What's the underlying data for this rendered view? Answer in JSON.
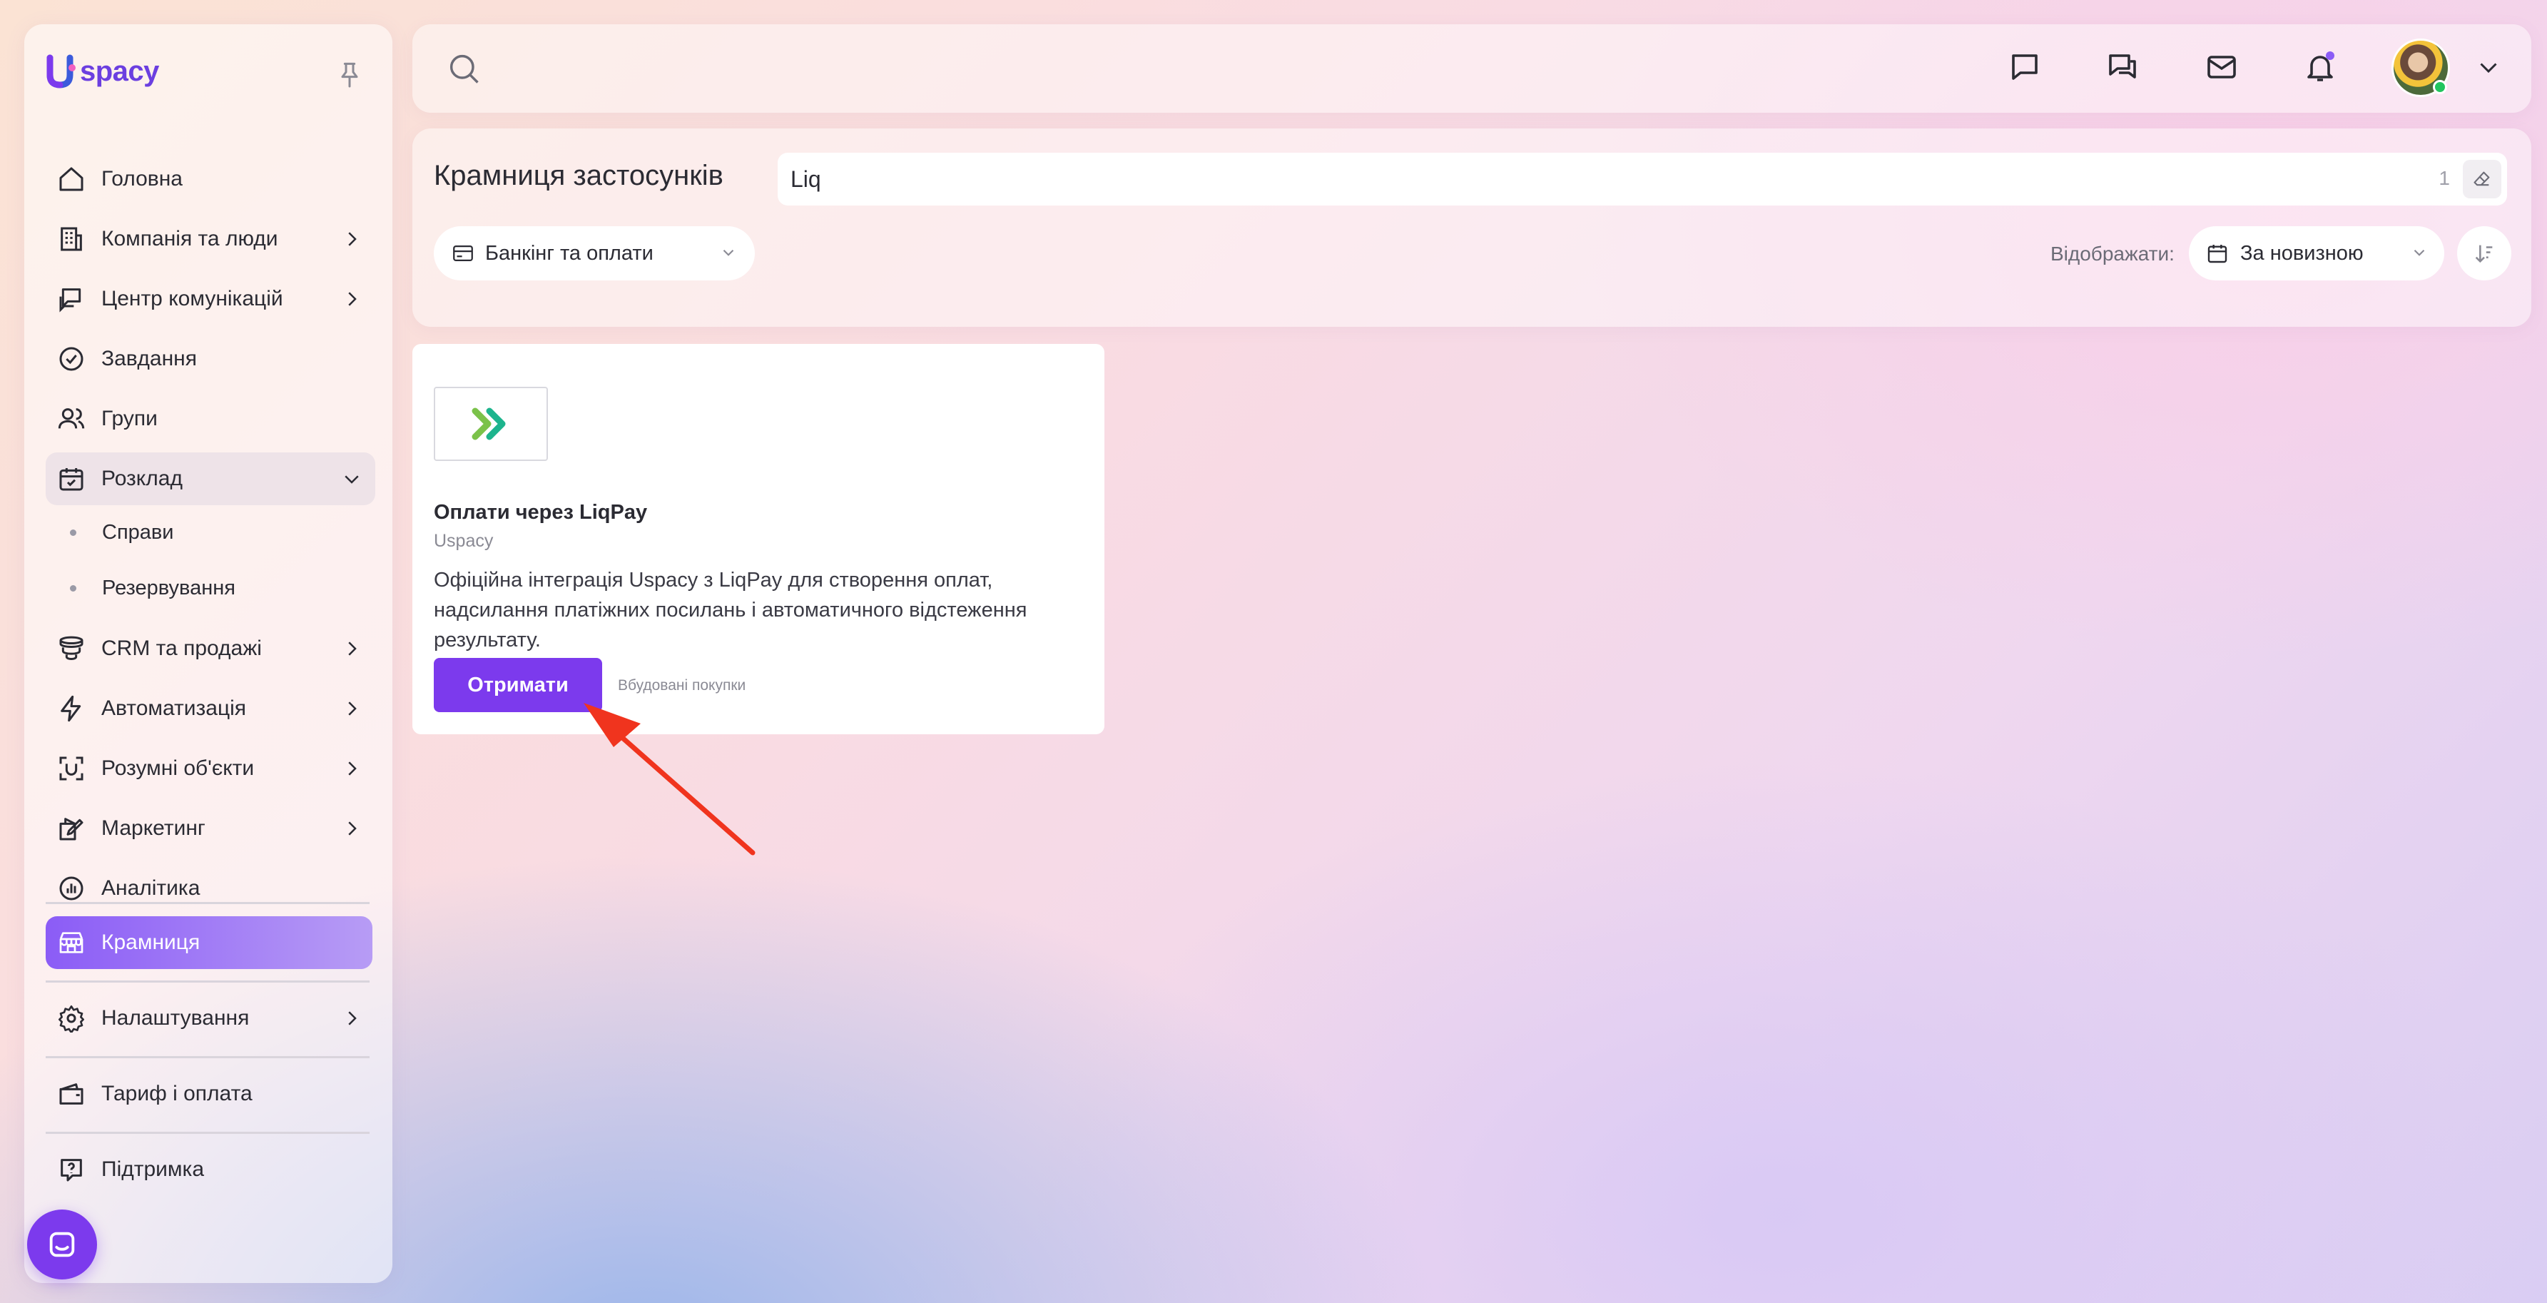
{
  "app": {
    "brand": "spacy"
  },
  "sidebar": {
    "items": [
      {
        "label": "Головна",
        "icon": "home-icon"
      },
      {
        "label": "Компанія та люди",
        "icon": "building-icon"
      },
      {
        "label": "Центр комунікацій",
        "icon": "communication-icon"
      },
      {
        "label": "Завдання",
        "icon": "check-circle-icon"
      },
      {
        "label": "Групи",
        "icon": "users-icon"
      },
      {
        "label": "Розклад",
        "icon": "calendar-check-icon"
      },
      {
        "label": "CRM та продажі",
        "icon": "funnel-icon"
      },
      {
        "label": "Автоматизація",
        "icon": "lightning-icon"
      },
      {
        "label": "Розумні об'єкти",
        "icon": "smart-object-icon"
      },
      {
        "label": "Маркетинг",
        "icon": "marketing-icon"
      },
      {
        "label": "Аналітика",
        "icon": "analytics-icon"
      },
      {
        "label": "Крамниця",
        "icon": "store-icon"
      },
      {
        "label": "Налаштування",
        "icon": "gear-icon"
      },
      {
        "label": "Тариф і оплата",
        "icon": "wallet-icon"
      },
      {
        "label": "Підтримка",
        "icon": "help-icon"
      }
    ],
    "schedule_subitems": [
      {
        "label": "Справи"
      },
      {
        "label": "Резервування"
      }
    ]
  },
  "store": {
    "title": "Крамниця застосунків",
    "search_value": "Liq",
    "search_count": "1",
    "category": "Банкінг та оплати",
    "show_label": "Відображати:",
    "sort": "За новизною"
  },
  "card": {
    "name": "Оплати через LiqPay",
    "vendor": "Uspacy",
    "description": "Офіційна інтеграція Uspacy з LiqPay для створення оплат, надсилання платіжних посилань і автоматичного відстеження результату.",
    "button": "Отримати",
    "tag": "Вбудовані покупки"
  },
  "colors": {
    "accent": "#7c3aed",
    "active_gradient_start": "#8b5cf6",
    "arrow": "#f0341e"
  }
}
